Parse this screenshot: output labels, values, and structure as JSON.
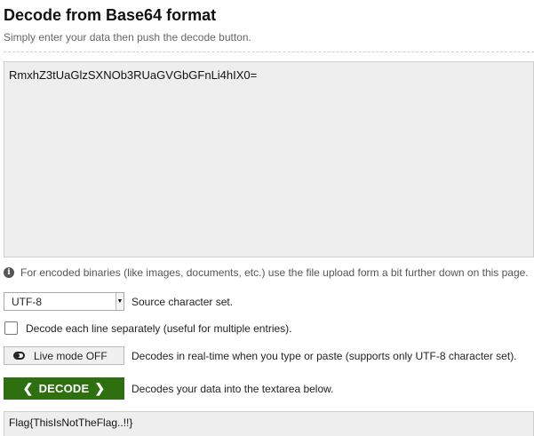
{
  "header": {
    "title": "Decode from Base64 format",
    "subtitle": "Simply enter your data then push the decode button."
  },
  "input": {
    "value": "RmxhZ3tUaGlzSXNOb3RUaGVGbGFnLi4hIX0="
  },
  "info": {
    "icon": "info-icon",
    "text": "For encoded binaries (like images, documents, etc.) use the file upload form a bit further down on this page."
  },
  "charset": {
    "selected": "UTF-8",
    "label": "Source character set."
  },
  "separate_lines": {
    "checked": false,
    "label": "Decode each line separately (useful for multiple entries)."
  },
  "live_mode": {
    "button_label": "Live mode OFF",
    "description": "Decodes in real-time when you type or paste (supports only UTF-8 character set)."
  },
  "decode": {
    "button_label": "DECODE",
    "description": "Decodes your data into the textarea below.",
    "color": "#2e6f10"
  },
  "output": {
    "value": "Flag{ThisIsNotTheFlag..!!}"
  }
}
